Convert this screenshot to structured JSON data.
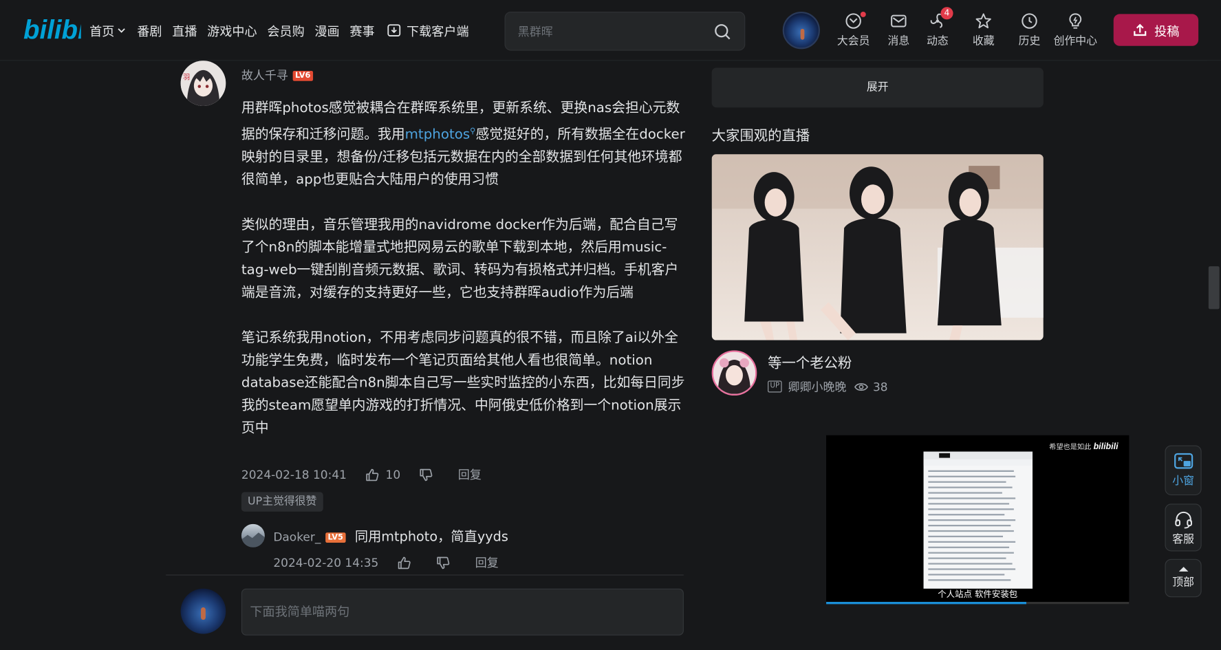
{
  "header": {
    "logo_text": "bilibili",
    "nav": [
      {
        "label": "首页",
        "has_dropdown": true
      },
      {
        "label": "番剧"
      },
      {
        "label": "直播"
      },
      {
        "label": "游戏中心"
      },
      {
        "label": "会员购"
      },
      {
        "label": "漫画"
      },
      {
        "label": "赛事"
      },
      {
        "label": "下载客户端",
        "icon": "download-icon"
      }
    ],
    "search": {
      "placeholder": "黑群晖",
      "icon": "search-icon"
    },
    "icons": [
      {
        "label": "大会员",
        "icon": "vip-icon",
        "dot": true
      },
      {
        "label": "消息",
        "icon": "message-icon"
      },
      {
        "label": "动态",
        "icon": "dynamic-icon",
        "badge": "4"
      },
      {
        "label": "收藏",
        "icon": "star-icon"
      },
      {
        "label": "历史",
        "icon": "clock-icon"
      },
      {
        "label": "创作中心",
        "icon": "bulb-icon"
      }
    ],
    "upload_label": "投稿",
    "accent": "#a8184a"
  },
  "comment": {
    "username": "故人千寻",
    "level": "LV6",
    "paragraphs": [
      {
        "pre": "用群晖photos感觉被耦合在群晖系统里，更新系统、更换nas会担心元数据的保存和迁移问题。我用",
        "link": "mtphotos",
        "post": "感觉挺好的，所有数据全在docker映射的目录里，想备份/迁移包括元数据在内的全部数据到任何其他环境都很简单，app也更贴合大陆用户的使用习惯"
      },
      {
        "text": "类似的理由，音乐管理我用的navidrome docker作为后端，配合自己写了个n8n的脚本能增量式地把网易云的歌单下载到本地，然后用music-tag-web一键刮削音频元数据、歌词、转码为有损格式并归档。手机客户端是音流，对缓存的支持更好一些，它也支持群晖audio作为后端"
      },
      {
        "text": "笔记系统我用notion，不用考虑同步问题真的很不错，而且除了ai以外全功能学生免费，临时发布一个笔记页面给其他人看也很简单。notion database还能配合n8n脚本自己写一些实时监控的小东西，比如每日同步我的steam愿望单内游戏的打折情况、中阿俄史低价格到一个notion展示页中"
      }
    ],
    "time": "2024-02-18 10:41",
    "likes": "10",
    "reply_label": "回复",
    "up_tag": "UP主觉得很赞"
  },
  "reply": {
    "username": "Daoker_",
    "level": "LV5",
    "text": "同用mtphoto，简直yyds",
    "time": "2024-02-20 14:35",
    "reply_label": "回复"
  },
  "composer": {
    "placeholder": "下面我简单喵两句"
  },
  "sidebar": {
    "expand_label": "展开",
    "live_heading": "大家围观的直播",
    "live": {
      "title": "等一个老公粉",
      "up_badge": "UP",
      "streamer": "卿卿小晚晚",
      "views": "38"
    }
  },
  "mini_player": {
    "watermark": "希望也是如此",
    "caption": "个人站点 软件安装包",
    "progress": 0.66
  },
  "side_buttons": {
    "mini_window": "小窗",
    "service": "客服",
    "top": "顶部"
  }
}
